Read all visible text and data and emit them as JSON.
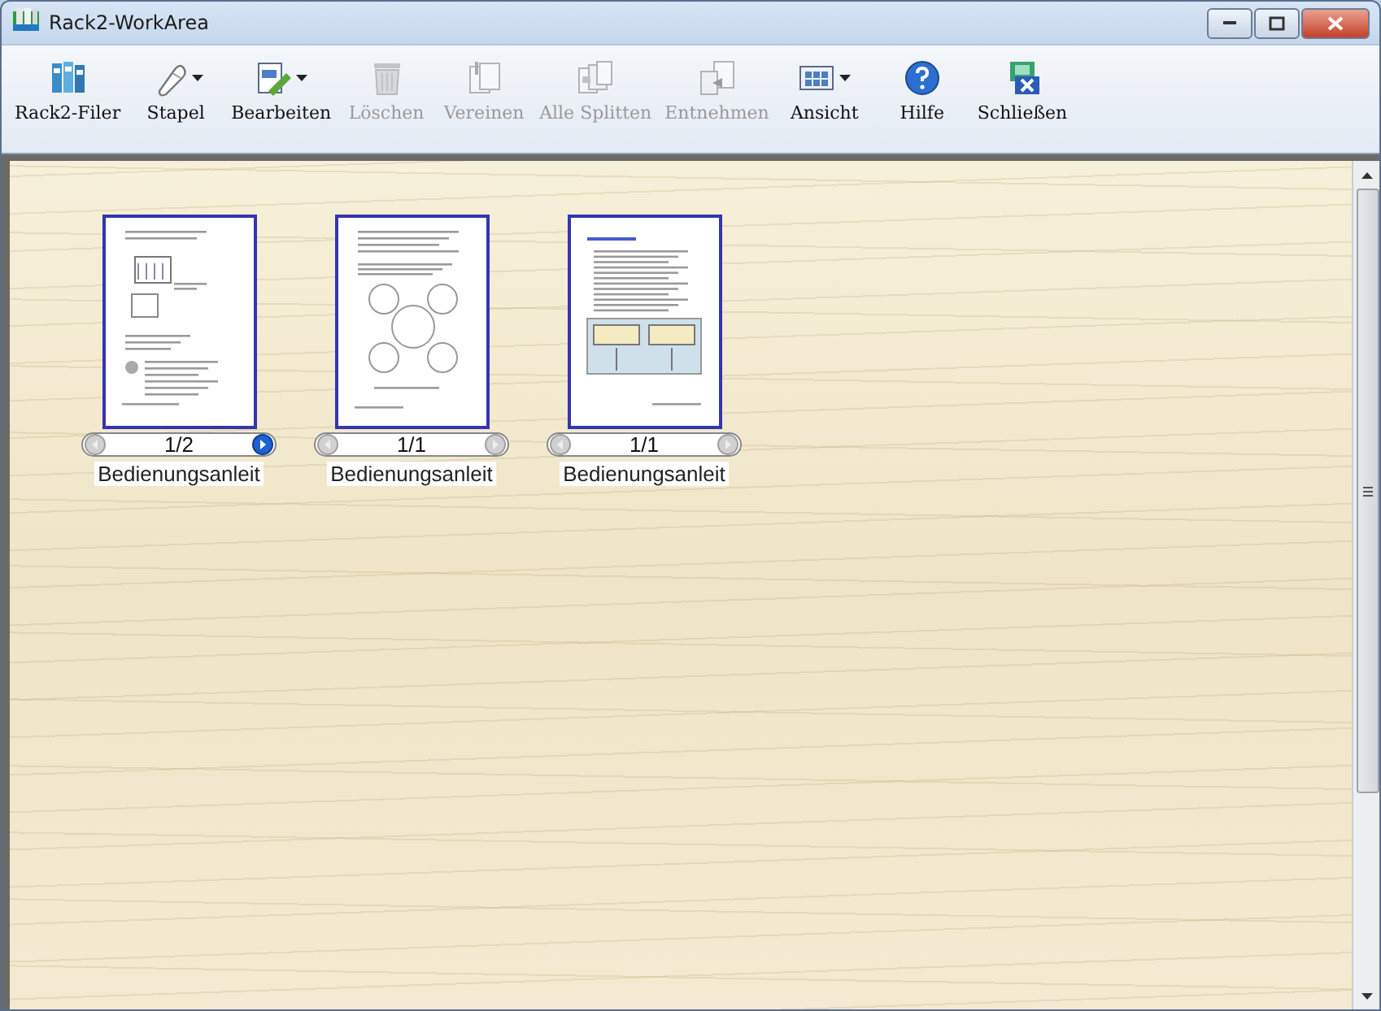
{
  "window": {
    "title": "Rack2-WorkArea"
  },
  "toolbar": [
    {
      "label": "Rack2-Filer",
      "kind": "binders",
      "disabled": false,
      "dropdown": false
    },
    {
      "label": "Stapel",
      "kind": "mouse",
      "disabled": false,
      "dropdown": true
    },
    {
      "label": "Bearbeiten",
      "kind": "edit",
      "disabled": false,
      "dropdown": true
    },
    {
      "label": "Löschen",
      "kind": "trash",
      "disabled": true,
      "dropdown": false
    },
    {
      "label": "Vereinen",
      "kind": "merge",
      "disabled": true,
      "dropdown": false
    },
    {
      "label": "Alle Splitten",
      "kind": "split",
      "disabled": true,
      "dropdown": false
    },
    {
      "label": "Entnehmen",
      "kind": "extract",
      "disabled": true,
      "dropdown": false
    },
    {
      "label": "Ansicht",
      "kind": "view",
      "disabled": false,
      "dropdown": true
    },
    {
      "label": "Hilfe",
      "kind": "help",
      "disabled": false,
      "dropdown": false
    },
    {
      "label": "Schließen",
      "kind": "close",
      "disabled": false,
      "dropdown": false
    }
  ],
  "documents": [
    {
      "kind": "list",
      "page": "1/2",
      "name": "Bedienungsanleit",
      "prev_enabled": false,
      "next_enabled": true
    },
    {
      "kind": "diagram",
      "page": "1/1",
      "name": "Bedienungsanleit",
      "prev_enabled": false,
      "next_enabled": false
    },
    {
      "kind": "figure",
      "page": "1/1",
      "name": "Bedienungsanleit",
      "prev_enabled": false,
      "next_enabled": false
    }
  ]
}
